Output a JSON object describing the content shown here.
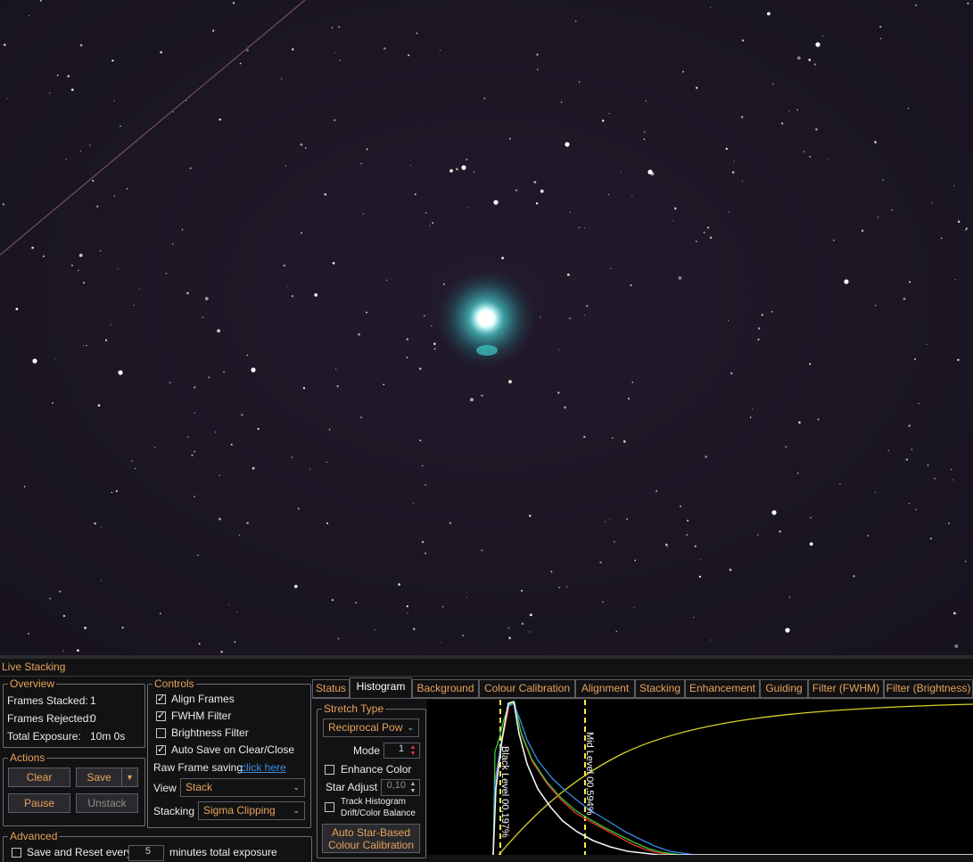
{
  "panel": {
    "title": "Live Stacking"
  },
  "overview": {
    "legend": "Overview",
    "frames_stacked_label": "Frames Stacked:",
    "frames_stacked": "1",
    "frames_rejected_label": "Frames Rejected:",
    "frames_rejected": "0",
    "total_exposure_label": "Total Exposure:",
    "total_exposure": "10m 0s"
  },
  "actions": {
    "legend": "Actions",
    "clear": "Clear",
    "save": "Save",
    "pause": "Pause",
    "unstack": "Unstack"
  },
  "advanced": {
    "legend": "Advanced",
    "save_reset_label": "Save and Reset every",
    "save_reset_value": "5",
    "save_reset_suffix": "minutes total exposure"
  },
  "controls": {
    "legend": "Controls",
    "align_frames": "Align Frames",
    "fwhm_filter": "FWHM Filter",
    "brightness_filter": "Brightness Filter",
    "auto_save": "Auto Save on Clear/Close",
    "raw_saving_label": "Raw Frame saving",
    "raw_saving_link": "click here",
    "view_label": "View",
    "view_value": "Stack",
    "stacking_label": "Stacking",
    "stacking_value": "Sigma Clipping"
  },
  "tabs": [
    "Status",
    "Histogram",
    "Background",
    "Colour Calibration",
    "Alignment",
    "Stacking",
    "Enhancement",
    "Guiding",
    "Filter (FWHM)",
    "Filter (Brightness)"
  ],
  "stretch": {
    "legend": "Stretch Type",
    "type_value": "Reciprocal Pow",
    "mode_label": "Mode",
    "mode_value": "1",
    "enhance_color": "Enhance Color",
    "star_adjust_label": "Star Adjust",
    "star_adjust_value": "0,10",
    "track_histogram_line1": "Track Histogram",
    "track_histogram_line2": "Drift/Color Balance",
    "auto_cal_line1": "Auto Star-Based",
    "auto_cal_line2": "Colour Calibration"
  },
  "histogram": {
    "black_level_label": "Black Level  00,197%",
    "mid_level_label": "Mid Level  00,594%"
  },
  "colors": {
    "accent": "#e8a25a",
    "link": "#3b8fe0",
    "sky": "#1c1626",
    "nebula": "#3fc6c6"
  }
}
